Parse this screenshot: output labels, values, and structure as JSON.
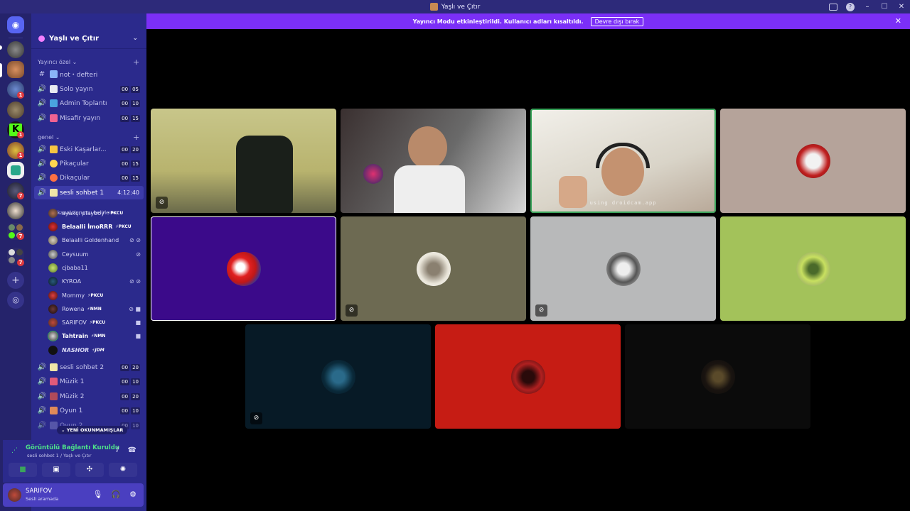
{
  "window": {
    "title": "Yaşlı ve Çıtır"
  },
  "notice": {
    "text": "Yayıncı Modu etkinleştirildi. Kullanıcı adları kısaltıldı.",
    "button": "Devre dışı bırak"
  },
  "server": {
    "name": "Yaşlı ve Çıtır"
  },
  "categories": {
    "first": "Yayıncı özel",
    "second": "genel"
  },
  "channels": {
    "not_defteri": {
      "name": "not・defteri"
    },
    "solo_yayin": {
      "name": "Solo yayın",
      "a": "00",
      "b": "05"
    },
    "admin_toplanti": {
      "name": "Admin Toplantı",
      "a": "00",
      "b": "10"
    },
    "misafir_yayin": {
      "name": "Misafir yayın",
      "a": "00",
      "b": "15"
    },
    "eski_kasarlar": {
      "name": "Eski Kaşarlar...",
      "a": "00",
      "b": "20"
    },
    "pikacular": {
      "name": "Pikaçular",
      "a": "00",
      "b": "15"
    },
    "dikacular": {
      "name": "Dikaçular",
      "a": "00",
      "b": "15"
    },
    "sesli_sohbet_1": {
      "name": "sesli sohbet 1",
      "time": "4:12:40"
    },
    "sesli_sohbet_2": {
      "name": "sesli sohbet 2",
      "a": "00",
      "b": "20"
    },
    "muzik_1": {
      "name": "Müzik 1",
      "a": "00",
      "b": "10"
    },
    "muzik_2": {
      "name": "Müzik 2",
      "a": "00",
      "b": "20"
    },
    "oyun_1": {
      "name": "Oyun 1",
      "a": "00",
      "b": "10"
    },
    "oyun_2": {
      "name": "Oyun 2",
      "a": "00",
      "b": "10"
    }
  },
  "status_prompt": "Bir kanal durumu belirle",
  "voice_users": [
    {
      "name": "ayakçı playboy",
      "tag": "⚡PKCU"
    },
    {
      "name": "Belaalli İmoRRR",
      "tag": "⚡PKCU"
    },
    {
      "name": "Belaalli Goldenhand",
      "tag": ""
    },
    {
      "name": "Ceysuum",
      "tag": ""
    },
    {
      "name": "cjbaba11",
      "tag": ""
    },
    {
      "name": "KYROA",
      "tag": ""
    },
    {
      "name": "Mommy",
      "tag": "⚡PKCU"
    },
    {
      "name": "Rowena",
      "tag": "⚡NMN"
    },
    {
      "name": "SARIFOV",
      "tag": "⚡PKCU"
    },
    {
      "name": "Tahtrain",
      "tag": "⚡NMN"
    },
    {
      "name": "𝙉𝘼𝙎𝙃𝙊𝙍",
      "tag": "⚡JDM"
    }
  ],
  "new_unread": "⌄ YENİ OKUNMAMIŞLAR",
  "voice_panel": {
    "status": "Görüntülü Bağlantı Kuruldu",
    "channel": "sesli sohbet 1 / Yaşlı ve Çıtır"
  },
  "user": {
    "name": "SARIFOV",
    "status": "Sesli aramada"
  },
  "video_watermark": "using droidcam.app",
  "guild_badges": [
    "1",
    "1",
    "1",
    "7",
    "7",
    "7"
  ],
  "colors": {
    "accent": "#7b2ff7",
    "sidebar": "#2b2a8c",
    "guildbar": "#25236b",
    "connected": "#4de08a",
    "speaking": "#3ba55c"
  }
}
